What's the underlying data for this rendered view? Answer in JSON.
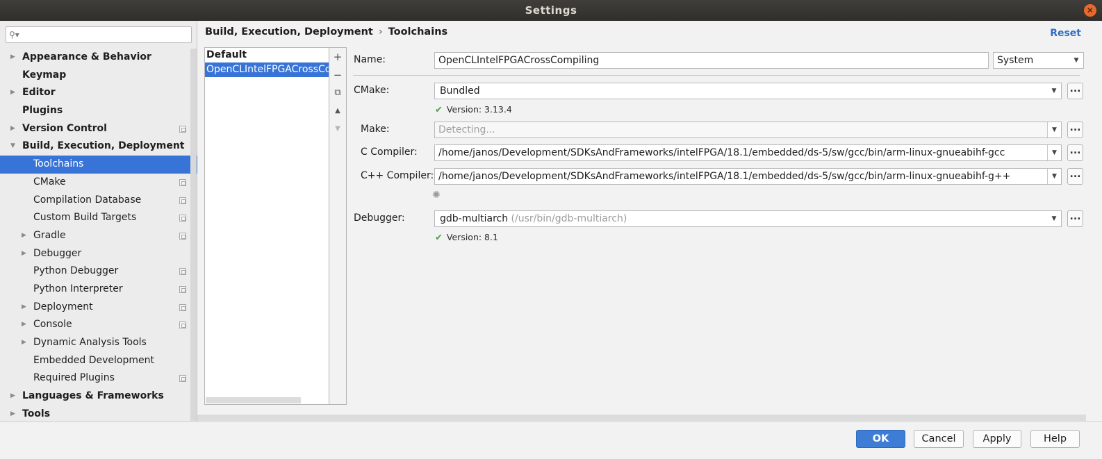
{
  "window": {
    "title": "Settings"
  },
  "sidebar": {
    "search_placeholder": "",
    "items": [
      {
        "label": "Appearance & Behavior",
        "level": 0,
        "arrow": true,
        "project": false
      },
      {
        "label": "Keymap",
        "level": 0,
        "arrow": false,
        "project": false
      },
      {
        "label": "Editor",
        "level": 0,
        "arrow": true,
        "project": false
      },
      {
        "label": "Plugins",
        "level": 0,
        "arrow": false,
        "project": false
      },
      {
        "label": "Version Control",
        "level": 0,
        "arrow": true,
        "project": true
      },
      {
        "label": "Build, Execution, Deployment",
        "level": 0,
        "arrow": "open",
        "project": false
      },
      {
        "label": "Toolchains",
        "level": 1,
        "arrow": false,
        "project": false,
        "selected": true
      },
      {
        "label": "CMake",
        "level": 1,
        "arrow": false,
        "project": true
      },
      {
        "label": "Compilation Database",
        "level": 1,
        "arrow": false,
        "project": true
      },
      {
        "label": "Custom Build Targets",
        "level": 1,
        "arrow": false,
        "project": true
      },
      {
        "label": "Gradle",
        "level": 1,
        "arrow": true,
        "project": true
      },
      {
        "label": "Debugger",
        "level": 1,
        "arrow": true,
        "project": false
      },
      {
        "label": "Python Debugger",
        "level": 1,
        "arrow": false,
        "project": true
      },
      {
        "label": "Python Interpreter",
        "level": 1,
        "arrow": false,
        "project": true
      },
      {
        "label": "Deployment",
        "level": 1,
        "arrow": true,
        "project": true
      },
      {
        "label": "Console",
        "level": 1,
        "arrow": true,
        "project": true
      },
      {
        "label": "Dynamic Analysis Tools",
        "level": 1,
        "arrow": true,
        "project": false
      },
      {
        "label": "Embedded Development",
        "level": 1,
        "arrow": false,
        "project": false
      },
      {
        "label": "Required Plugins",
        "level": 1,
        "arrow": false,
        "project": true
      },
      {
        "label": "Languages & Frameworks",
        "level": 0,
        "arrow": true,
        "project": false
      },
      {
        "label": "Tools",
        "level": 0,
        "arrow": true,
        "project": false
      }
    ]
  },
  "breadcrumb": {
    "parent": "Build, Execution, Deployment",
    "separator": "›",
    "current": "Toolchains"
  },
  "reset_label": "Reset",
  "toolchains": {
    "items": [
      {
        "label": "Default",
        "bold": true
      },
      {
        "label": "OpenCLIntelFPGACrossCompiling",
        "selected": true
      }
    ],
    "toolbar": {
      "add": "+",
      "remove": "−",
      "copy": "⧉",
      "up": "▲",
      "down": "▼"
    }
  },
  "form": {
    "name_label": "Name:",
    "name_value": "OpenCLIntelFPGACrossCompiling",
    "environment_value": "System",
    "cmake_label": "CMake:",
    "cmake_value": "Bundled",
    "cmake_version": "Version: 3.13.4",
    "make_label": "Make:",
    "make_value": "Detecting...",
    "c_compiler_label": "C Compiler:",
    "c_compiler_value": "/home/janos/Development/SDKsAndFrameworks/intelFPGA/18.1/embedded/ds-5/sw/gcc/bin/arm-linux-gnueabihf-gcc",
    "cpp_compiler_label": "C++ Compiler:",
    "cpp_compiler_value": "/home/janos/Development/SDKsAndFrameworks/intelFPGA/18.1/embedded/ds-5/sw/gcc/bin/arm-linux-gnueabihf-g++",
    "debugger_label": "Debugger:",
    "debugger_value": "gdb-multiarch",
    "debugger_path": "(/usr/bin/gdb-multiarch)",
    "debugger_version": "Version: 8.1",
    "browse_label": "...",
    "check_glyph": "✔"
  },
  "footer": {
    "ok": "OK",
    "cancel": "Cancel",
    "apply": "Apply",
    "help": "Help"
  }
}
